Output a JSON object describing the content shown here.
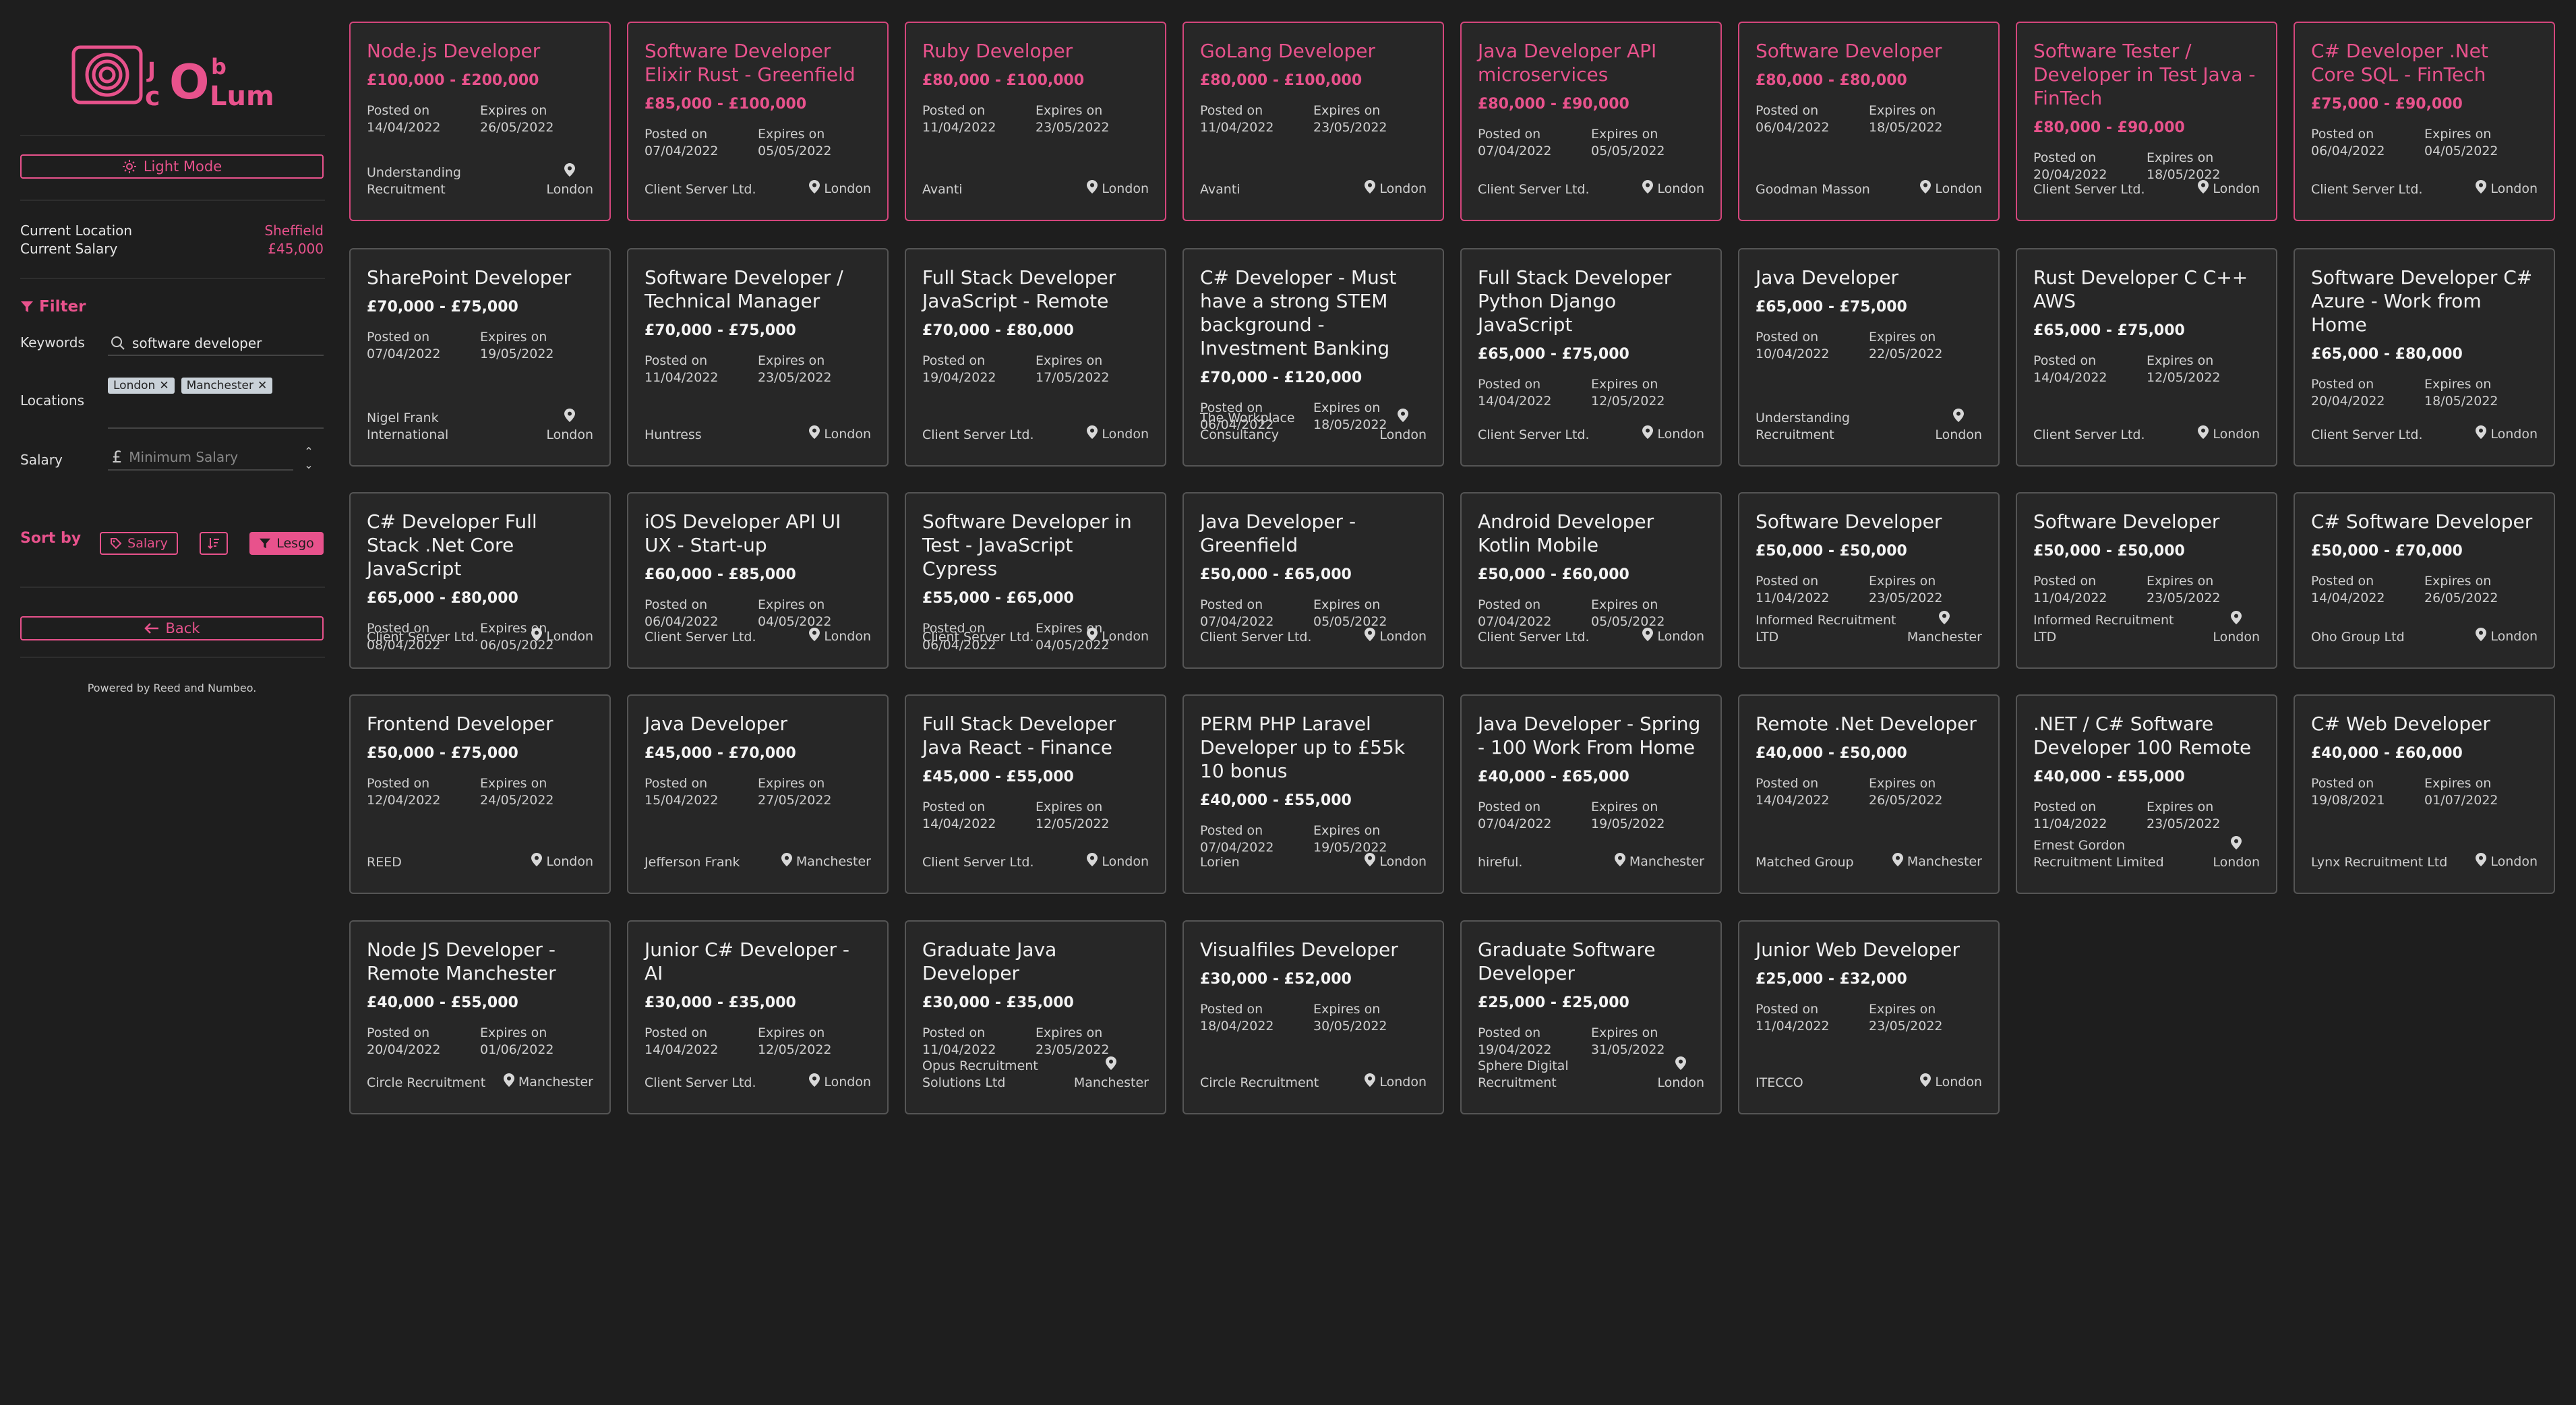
{
  "sidebar": {
    "logo_text": "JobColumn",
    "light_mode_label": "Light Mode",
    "current_location_label": "Current Location",
    "current_location_value": "Sheffield",
    "current_salary_label": "Current Salary",
    "current_salary_value": "£45,000",
    "filter_heading": "Filter",
    "keywords_label": "Keywords",
    "keywords_value": "software developer",
    "locations_label": "Locations",
    "locations": [
      "London",
      "Manchester"
    ],
    "salary_label": "Salary",
    "salary_placeholder": "Minimum Salary",
    "sort_heading": "Sort by",
    "sort_salary_label": "Salary",
    "lesgo_label": "Lesgo",
    "back_label": "Back",
    "powered_by": "Powered by Reed and Numbeo."
  },
  "card_labels": {
    "posted": "Posted on",
    "expires": "Expires on"
  },
  "accent_color": "#e8528c",
  "jobs": [
    {
      "title": "Node.js Developer",
      "salary": "£100,000 - £200,000",
      "posted": "14/04/2022",
      "expires": "26/05/2022",
      "company": "Understanding Recruitment",
      "location": "London",
      "highlight": true
    },
    {
      "title": "Software Developer Elixir Rust - Greenfield",
      "salary": "£85,000 - £100,000",
      "posted": "07/04/2022",
      "expires": "05/05/2022",
      "company": "Client Server Ltd.",
      "location": "London",
      "highlight": true
    },
    {
      "title": "Ruby Developer",
      "salary": "£80,000 - £100,000",
      "posted": "11/04/2022",
      "expires": "23/05/2022",
      "company": "Avanti",
      "location": "London",
      "highlight": true
    },
    {
      "title": "GoLang Developer",
      "salary": "£80,000 - £100,000",
      "posted": "11/04/2022",
      "expires": "23/05/2022",
      "company": "Avanti",
      "location": "London",
      "highlight": true
    },
    {
      "title": "Java Developer API microservices",
      "salary": "£80,000 - £90,000",
      "posted": "07/04/2022",
      "expires": "05/05/2022",
      "company": "Client Server Ltd.",
      "location": "London",
      "highlight": true
    },
    {
      "title": "Software Developer",
      "salary": "£80,000 - £80,000",
      "posted": "06/04/2022",
      "expires": "18/05/2022",
      "company": "Goodman Masson",
      "location": "London",
      "highlight": true
    },
    {
      "title": "Software Tester / Developer in Test Java - FinTech",
      "salary": "£80,000 - £90,000",
      "posted": "20/04/2022",
      "expires": "18/05/2022",
      "company": "Client Server Ltd.",
      "location": "London",
      "highlight": true
    },
    {
      "title": "C# Developer .Net Core SQL - FinTech",
      "salary": "£75,000 - £90,000",
      "posted": "06/04/2022",
      "expires": "04/05/2022",
      "company": "Client Server Ltd.",
      "location": "London",
      "highlight": true
    },
    {
      "title": "SharePoint Developer",
      "salary": "£70,000 - £75,000",
      "posted": "07/04/2022",
      "expires": "19/05/2022",
      "company": "Nigel Frank International",
      "location": "London",
      "highlight": false
    },
    {
      "title": "Software Developer / Technical Manager",
      "salary": "£70,000 - £75,000",
      "posted": "11/04/2022",
      "expires": "23/05/2022",
      "company": "Huntress",
      "location": "London",
      "highlight": false
    },
    {
      "title": "Full Stack Developer JavaScript - Remote",
      "salary": "£70,000 - £80,000",
      "posted": "19/04/2022",
      "expires": "17/05/2022",
      "company": "Client Server Ltd.",
      "location": "London",
      "highlight": false
    },
    {
      "title": "C# Developer - Must have a strong STEM background - Investment Banking",
      "salary": "£70,000 - £120,000",
      "posted": "06/04/2022",
      "expires": "18/05/2022",
      "company": "The Workplace Consultancy",
      "location": "London",
      "highlight": false
    },
    {
      "title": "Full Stack Developer Python Django JavaScript",
      "salary": "£65,000 - £75,000",
      "posted": "14/04/2022",
      "expires": "12/05/2022",
      "company": "Client Server Ltd.",
      "location": "London",
      "highlight": false
    },
    {
      "title": "Java Developer",
      "salary": "£65,000 - £75,000",
      "posted": "10/04/2022",
      "expires": "22/05/2022",
      "company": "Understanding Recruitment",
      "location": "London",
      "highlight": false
    },
    {
      "title": "Rust Developer C C++ AWS",
      "salary": "£65,000 - £75,000",
      "posted": "14/04/2022",
      "expires": "12/05/2022",
      "company": "Client Server Ltd.",
      "location": "London",
      "highlight": false
    },
    {
      "title": "Software Developer C# Azure - Work from Home",
      "salary": "£65,000 - £80,000",
      "posted": "20/04/2022",
      "expires": "18/05/2022",
      "company": "Client Server Ltd.",
      "location": "London",
      "highlight": false
    },
    {
      "title": "C# Developer Full Stack .Net Core JavaScript",
      "salary": "£65,000 - £80,000",
      "posted": "08/04/2022",
      "expires": "06/05/2022",
      "company": "Client Server Ltd.",
      "location": "London",
      "highlight": false
    },
    {
      "title": "iOS Developer API UI UX - Start-up",
      "salary": "£60,000 - £85,000",
      "posted": "06/04/2022",
      "expires": "04/05/2022",
      "company": "Client Server Ltd.",
      "location": "London",
      "highlight": false
    },
    {
      "title": "Software Developer in Test - JavaScript Cypress",
      "salary": "£55,000 - £65,000",
      "posted": "06/04/2022",
      "expires": "04/05/2022",
      "company": "Client Server Ltd.",
      "location": "London",
      "highlight": false
    },
    {
      "title": "Java Developer - Greenfield",
      "salary": "£50,000 - £65,000",
      "posted": "07/04/2022",
      "expires": "05/05/2022",
      "company": "Client Server Ltd.",
      "location": "London",
      "highlight": false
    },
    {
      "title": "Android Developer Kotlin Mobile",
      "salary": "£50,000 - £60,000",
      "posted": "07/04/2022",
      "expires": "05/05/2022",
      "company": "Client Server Ltd.",
      "location": "London",
      "highlight": false
    },
    {
      "title": "Software Developer",
      "salary": "£50,000 - £50,000",
      "posted": "11/04/2022",
      "expires": "23/05/2022",
      "company": "Informed Recruitment LTD",
      "location": "Manchester",
      "highlight": false
    },
    {
      "title": "Software Developer",
      "salary": "£50,000 - £50,000",
      "posted": "11/04/2022",
      "expires": "23/05/2022",
      "company": "Informed Recruitment LTD",
      "location": "London",
      "highlight": false
    },
    {
      "title": "C# Software Developer",
      "salary": "£50,000 - £70,000",
      "posted": "14/04/2022",
      "expires": "26/05/2022",
      "company": "Oho Group Ltd",
      "location": "London",
      "highlight": false
    },
    {
      "title": "Frontend Developer",
      "salary": "£50,000 - £75,000",
      "posted": "12/04/2022",
      "expires": "24/05/2022",
      "company": "REED",
      "location": "London",
      "highlight": false
    },
    {
      "title": "Java Developer",
      "salary": "£45,000 - £70,000",
      "posted": "15/04/2022",
      "expires": "27/05/2022",
      "company": "Jefferson Frank",
      "location": "Manchester",
      "highlight": false
    },
    {
      "title": "Full Stack Developer Java React - Finance",
      "salary": "£45,000 - £55,000",
      "posted": "14/04/2022",
      "expires": "12/05/2022",
      "company": "Client Server Ltd.",
      "location": "London",
      "highlight": false
    },
    {
      "title": "PERM PHP Laravel Developer up to £55k 10 bonus",
      "salary": "£40,000 - £55,000",
      "posted": "07/04/2022",
      "expires": "19/05/2022",
      "company": "Lorien",
      "location": "London",
      "highlight": false
    },
    {
      "title": "Java Developer - Spring - 100 Work From Home",
      "salary": "£40,000 - £65,000",
      "posted": "07/04/2022",
      "expires": "19/05/2022",
      "company": "hireful.",
      "location": "Manchester",
      "highlight": false
    },
    {
      "title": "Remote .Net Developer",
      "salary": "£40,000 - £50,000",
      "posted": "14/04/2022",
      "expires": "26/05/2022",
      "company": "Matched Group",
      "location": "Manchester",
      "highlight": false
    },
    {
      "title": ".NET / C# Software Developer 100 Remote",
      "salary": "£40,000 - £55,000",
      "posted": "11/04/2022",
      "expires": "23/05/2022",
      "company": "Ernest Gordon Recruitment Limited",
      "location": "London",
      "highlight": false
    },
    {
      "title": "C# Web Developer",
      "salary": "£40,000 - £60,000",
      "posted": "19/08/2021",
      "expires": "01/07/2022",
      "company": "Lynx Recruitment Ltd",
      "location": "London",
      "highlight": false
    },
    {
      "title": "Node JS Developer - Remote Manchester",
      "salary": "£40,000 - £55,000",
      "posted": "20/04/2022",
      "expires": "01/06/2022",
      "company": "Circle Recruitment",
      "location": "Manchester",
      "highlight": false
    },
    {
      "title": "Junior C# Developer - AI",
      "salary": "£30,000 - £35,000",
      "posted": "14/04/2022",
      "expires": "12/05/2022",
      "company": "Client Server Ltd.",
      "location": "London",
      "highlight": false
    },
    {
      "title": "Graduate Java Developer",
      "salary": "£30,000 - £35,000",
      "posted": "11/04/2022",
      "expires": "23/05/2022",
      "company": "Opus Recruitment Solutions Ltd",
      "location": "Manchester",
      "highlight": false
    },
    {
      "title": "Visualfiles Developer",
      "salary": "£30,000 - £52,000",
      "posted": "18/04/2022",
      "expires": "30/05/2022",
      "company": "Circle Recruitment",
      "location": "London",
      "highlight": false
    },
    {
      "title": "Graduate Software Developer",
      "salary": "£25,000 - £25,000",
      "posted": "19/04/2022",
      "expires": "31/05/2022",
      "company": "Sphere Digital Recruitment",
      "location": "London",
      "highlight": false
    },
    {
      "title": "Junior Web Developer",
      "salary": "£25,000 - £32,000",
      "posted": "11/04/2022",
      "expires": "23/05/2022",
      "company": "ITECCO",
      "location": "London",
      "highlight": false
    }
  ]
}
